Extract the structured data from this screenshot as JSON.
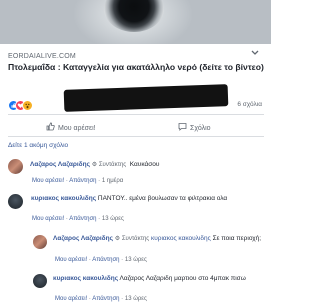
{
  "post": {
    "source": "EORDAIALIVE.COM",
    "headline": "Πτολεμαΐδα : Καταγγελία για ακατάλληλο νερό (δείτε το βίντεο)",
    "comments_count": "6 σχόλια"
  },
  "actions": {
    "like": "Μου αρέσει!",
    "comment": "Σχόλιο"
  },
  "more_comments": "Δείτε 1 ακόμη σχόλιο",
  "comments": [
    {
      "author": "Λαζαρος Λαζαριδης",
      "badge": "Συντάκτης",
      "text": "Καυκάσου",
      "like": "Μου αρέσει!",
      "reply": "Απάντηση",
      "time": "1 ημέρα"
    },
    {
      "author": "κυριακος κακουλιδης",
      "text": "ΠΑΝΤΟΥ.. εμένα βουλωσαν τα φιλτρακια ολα",
      "like": "Μου αρέσει!",
      "reply": "Απάντηση",
      "time": "13 ώρες"
    },
    {
      "author": "Λαζαρος Λαζαριδης",
      "badge": "Συντάκτης",
      "mention": "κυριακος κακουλιδης",
      "text": "Σε ποια περιοχή;",
      "like": "Μου αρέσει!",
      "reply": "Απάντηση",
      "time": "13 ώρες"
    },
    {
      "author": "κυριακος κακουλιδης",
      "text": "Λαζαρος Λαζαριδη μαρτιου στο 4μπακ πισω",
      "like": "Μου αρέσει!",
      "reply": "Απάντηση",
      "time": "13 ώρες"
    }
  ]
}
